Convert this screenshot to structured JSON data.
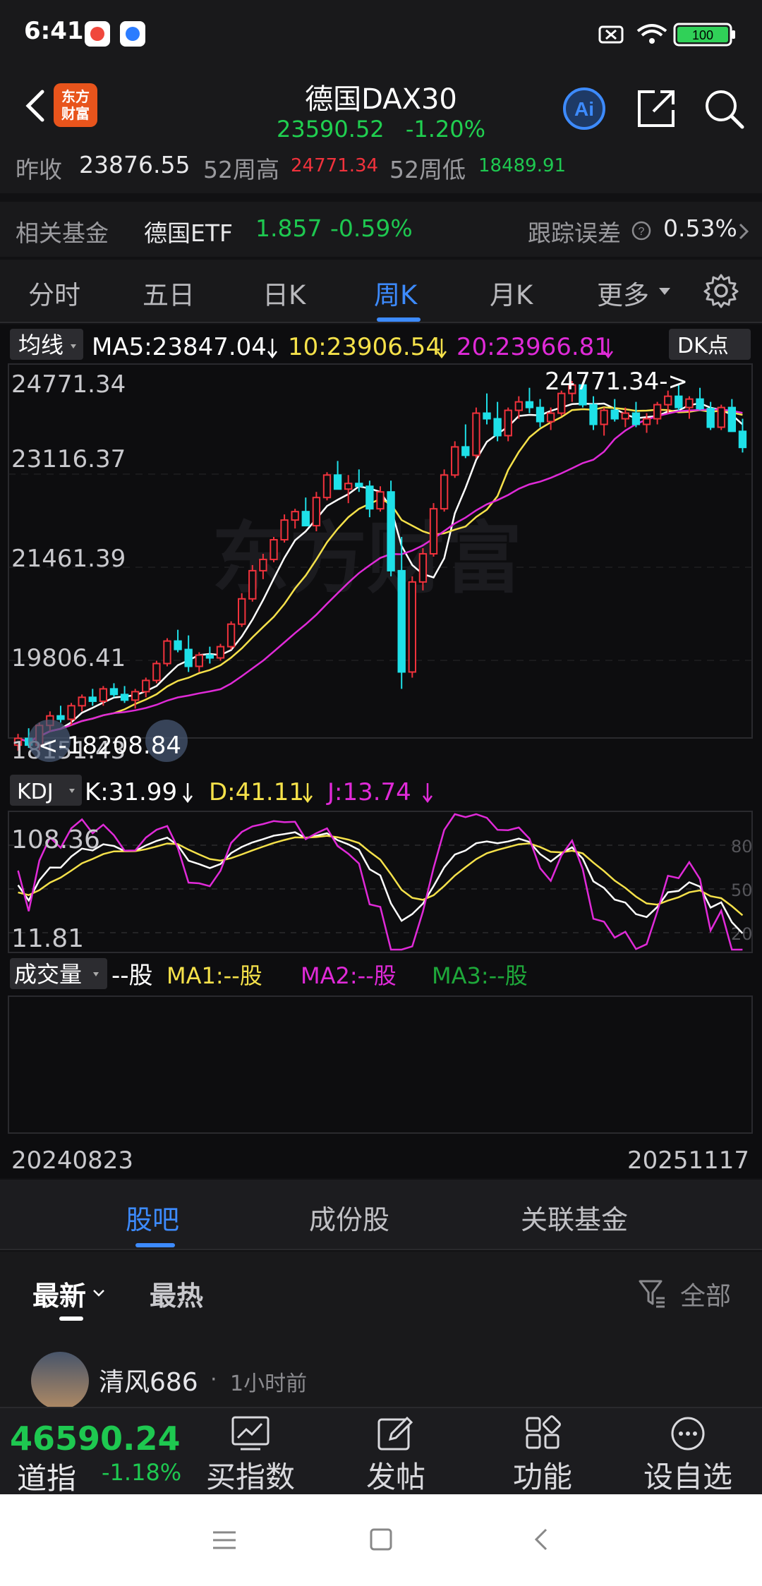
{
  "status_bar": {
    "time": "6:41",
    "battery": "100"
  },
  "header": {
    "title": "德国DAX30",
    "price": "23590.52",
    "change_pct": "-1.20%",
    "logo_line1": "东方",
    "logo_line2": "财富",
    "ai_label": "Ai"
  },
  "quote": {
    "prev_close_label": "昨收",
    "prev_close": "23876.55",
    "high52_label": "52周高",
    "high52": "24771.34",
    "low52_label": "52周低",
    "low52": "18489.91"
  },
  "fund": {
    "label": "相关基金",
    "name": "德国ETF",
    "price": "1.857",
    "change": "-0.59%",
    "tracking_label": "跟踪误差",
    "tracking_value": "0.53%"
  },
  "period_tabs": [
    "分时",
    "五日",
    "日K",
    "周K",
    "月K",
    "更多"
  ],
  "active_period_index": 3,
  "chart": {
    "ma_selector": "均线",
    "ma5": "MA5:23847.04",
    "ma10": "10:23906.54",
    "ma20": "20:23966.81",
    "dk_label": "DK点",
    "y_labels": [
      "24771.34",
      "23116.37",
      "21461.39",
      "19806.41",
      "18151.43"
    ],
    "max_annotation": "24771.34->",
    "min_annotation": "<-18208.84",
    "watermark": "东方财富",
    "kdj_selector": "KDJ",
    "kdj_k": "K:31.99",
    "kdj_d": "D:41.11",
    "kdj_j": "J:13.74",
    "kdj_top": "108.36",
    "kdj_bottom": "11.81",
    "kdj_levels": [
      "80",
      "50",
      "20"
    ],
    "vol_selector": "成交量",
    "vol_value": "--股",
    "vol_ma1": "MA1:--股",
    "vol_ma2": "MA2:--股",
    "vol_ma3": "MA3:--股",
    "date_start": "20240823",
    "date_end": "20251117"
  },
  "chart_data": {
    "type": "candlestick",
    "ylim": [
      18151.43,
      24771.34
    ],
    "candles": [
      [
        18300,
        18500,
        18200,
        18420
      ],
      [
        18420,
        18600,
        18250,
        18300
      ],
      [
        18300,
        18700,
        18208.84,
        18650
      ],
      [
        18650,
        18900,
        18550,
        18820
      ],
      [
        18820,
        19000,
        18700,
        18760
      ],
      [
        18760,
        19050,
        18650,
        19000
      ],
      [
        19000,
        19200,
        18900,
        19150
      ],
      [
        19150,
        19300,
        19000,
        19080
      ],
      [
        19080,
        19350,
        19000,
        19300
      ],
      [
        19300,
        19400,
        19150,
        19200
      ],
      [
        19200,
        19350,
        19050,
        19100
      ],
      [
        19100,
        19300,
        18950,
        19250
      ],
      [
        19250,
        19500,
        19150,
        19450
      ],
      [
        19450,
        19800,
        19400,
        19750
      ],
      [
        19750,
        20200,
        19700,
        20150
      ],
      [
        20150,
        20350,
        19950,
        20000
      ],
      [
        20000,
        20250,
        19600,
        19700
      ],
      [
        19700,
        19950,
        19600,
        19900
      ],
      [
        19900,
        20050,
        19750,
        19850
      ],
      [
        19850,
        20100,
        19800,
        20050
      ],
      [
        20050,
        20500,
        20000,
        20450
      ],
      [
        20450,
        21000,
        20400,
        20900
      ],
      [
        20900,
        21500,
        20850,
        21400
      ],
      [
        21400,
        21700,
        21250,
        21600
      ],
      [
        21600,
        22000,
        21550,
        21950
      ],
      [
        21950,
        22400,
        21900,
        22300
      ],
      [
        22300,
        22500,
        22150,
        22450
      ],
      [
        22450,
        22700,
        22300,
        22200
      ],
      [
        22200,
        22800,
        22100,
        22700
      ],
      [
        22700,
        23150,
        22650,
        23100
      ],
      [
        23100,
        23350,
        22900,
        22850
      ],
      [
        22850,
        23100,
        22600,
        22950
      ],
      [
        22950,
        23200,
        22800,
        22900
      ],
      [
        22900,
        23000,
        22350,
        22500
      ],
      [
        22500,
        22900,
        22450,
        22800
      ],
      [
        22800,
        23000,
        21300,
        21400
      ],
      [
        21400,
        22000,
        19300,
        19600
      ],
      [
        19600,
        21300,
        19500,
        21200
      ],
      [
        21200,
        21800,
        21050,
        21700
      ],
      [
        21700,
        22600,
        21650,
        22500
      ],
      [
        22500,
        23200,
        22450,
        23100
      ],
      [
        23100,
        23700,
        23050,
        23600
      ],
      [
        23600,
        24000,
        23400,
        23450
      ],
      [
        23450,
        24300,
        23400,
        24200
      ],
      [
        24200,
        24550,
        24000,
        24100
      ],
      [
        24100,
        24400,
        23700,
        23800
      ],
      [
        23800,
        24300,
        23700,
        24250
      ],
      [
        24250,
        24500,
        24100,
        24400
      ],
      [
        24400,
        24650,
        24200,
        24300
      ],
      [
        24300,
        24450,
        23950,
        24050
      ],
      [
        24050,
        24300,
        23900,
        24200
      ],
      [
        24200,
        24600,
        24150,
        24550
      ],
      [
        24550,
        24771.34,
        24400,
        24700
      ],
      [
        24700,
        24750,
        24300,
        24350
      ],
      [
        24350,
        24500,
        23900,
        24000
      ],
      [
        24000,
        24300,
        23800,
        24250
      ],
      [
        24250,
        24450,
        24050,
        24100
      ],
      [
        24100,
        24300,
        23950,
        24200
      ],
      [
        24200,
        24400,
        23950,
        24000
      ],
      [
        24000,
        24200,
        23850,
        24100
      ],
      [
        24100,
        24400,
        24000,
        24350
      ],
      [
        24350,
        24600,
        24200,
        24500
      ],
      [
        24500,
        24700,
        24250,
        24300
      ],
      [
        24300,
        24500,
        24100,
        24450
      ],
      [
        24450,
        24650,
        24250,
        24280
      ],
      [
        24280,
        24400,
        23900,
        23950
      ],
      [
        23950,
        24350,
        23900,
        24300
      ],
      [
        24300,
        24450,
        23876,
        23876.55
      ],
      [
        23876.55,
        24100,
        23500,
        23590.52
      ]
    ]
  },
  "section_tabs": [
    "股吧",
    "成份股",
    "关联基金"
  ],
  "feed_tabs": {
    "latest": "最新",
    "hot": "最热",
    "filter": "全部"
  },
  "post": {
    "author": "清风686",
    "time": "1小时前"
  },
  "toolbar": {
    "ticker_value": "46590.24",
    "ticker_name": "道指",
    "ticker_change": "-1.18%",
    "buy": "买指数",
    "post": "发帖",
    "functions": "功能",
    "watchlist": "设自选"
  }
}
